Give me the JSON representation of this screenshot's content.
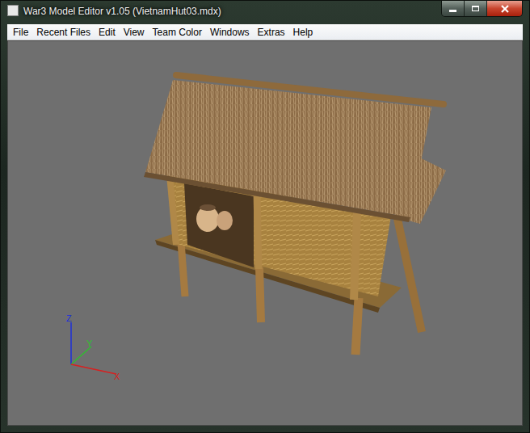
{
  "window": {
    "title": "War3 Model Editor v1.05 (VietnamHut03.mdx)"
  },
  "menu": [
    {
      "label": "File"
    },
    {
      "label": "Recent Files"
    },
    {
      "label": "Edit"
    },
    {
      "label": "View"
    },
    {
      "label": "Team Color"
    },
    {
      "label": "Windows"
    },
    {
      "label": "Extras"
    },
    {
      "label": "Help"
    }
  ],
  "axes": [
    {
      "label": "Z",
      "color": "#1e2fd8"
    },
    {
      "label": "Y",
      "color": "#2fbf2f"
    },
    {
      "label": "X",
      "color": "#d82020"
    }
  ]
}
